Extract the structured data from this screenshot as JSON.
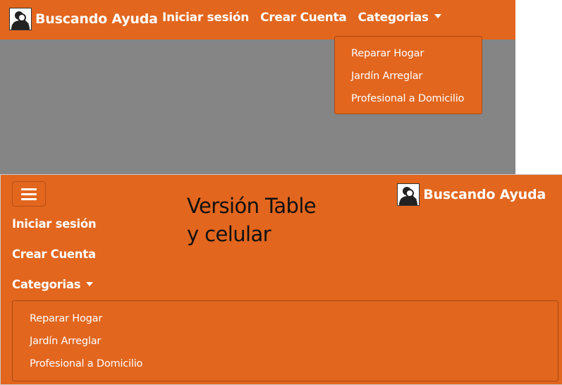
{
  "brand": {
    "name": "Buscando Ayuda",
    "logo_icon": "person-search-icon"
  },
  "nav": {
    "login": "Iniciar sesión",
    "signup": "Crear Cuenta",
    "categories": "Categorias"
  },
  "categories_menu": [
    "Reparar Hogar",
    "Jardín Arreglar",
    "Profesional a Domicilio"
  ],
  "mobile_note": {
    "line1": "Versión Table",
    "line2": "y celular"
  },
  "colors": {
    "navbar": "#e2661e",
    "backdrop": "#858585",
    "text": "#ffffff"
  }
}
